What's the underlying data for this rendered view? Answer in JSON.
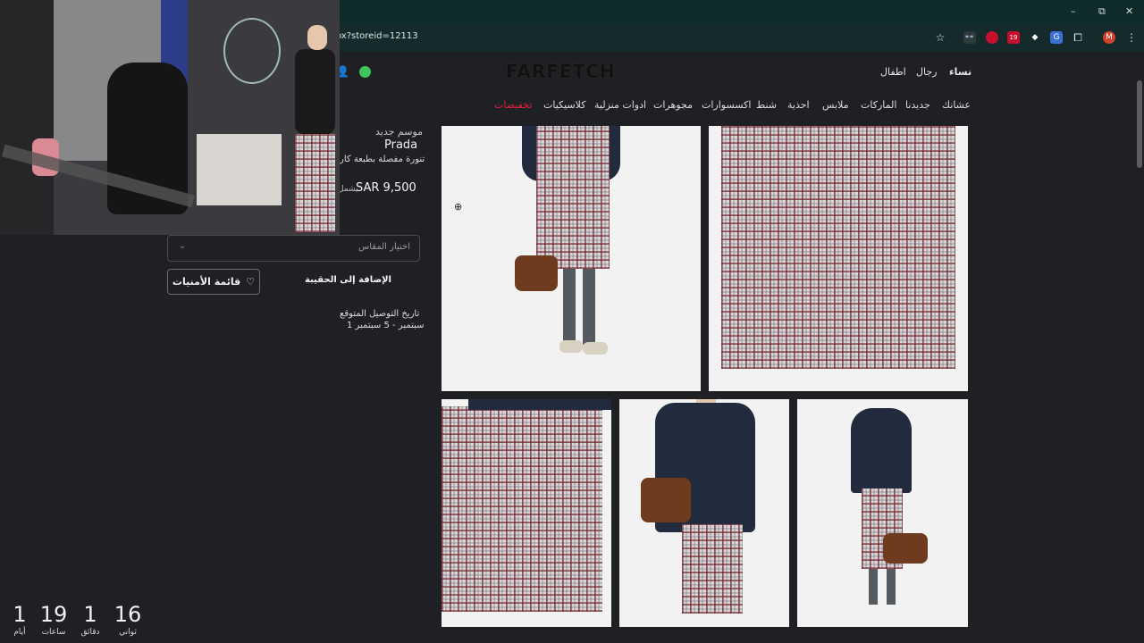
{
  "browser": {
    "url": "ox?storeid=12113",
    "window_controls": {
      "minimize": "–",
      "restore": "⧉",
      "close": "✕"
    },
    "toolbar_icons": [
      "star-icon",
      "incognito-icon",
      "extension-red-icon",
      "extension-badge-icon",
      "extension-diamond-icon",
      "translate-icon",
      "extensions-puzzle-icon",
      "profile-avatar-icon",
      "menu-kebab-icon"
    ],
    "extension_badge": "19",
    "profile_initial": "M"
  },
  "header": {
    "logo": "FARFETCH",
    "gender_links": [
      "نساء",
      "رجال",
      "اطفال"
    ],
    "nav_items": [
      "عشانك",
      "جديدنا",
      "الماركات",
      "ملابس",
      "احذية",
      "شنط",
      "اكسسوارات",
      "مجوهرات",
      "ادوات منزلية",
      "كلاسيكيات",
      "تخفيضات"
    ],
    "sale_color": "#e0203a"
  },
  "product": {
    "season": "موسم جديد",
    "brand": "Prada",
    "name": "تنورة مفصلة بطبعة كار",
    "price": "SAR 9,500",
    "price_note": "يشمل",
    "size_placeholder": "اختيار المقاس",
    "add_to_bag": "الإضافة إلى الحقيبة",
    "wishlist": "قائمة الأمنيات",
    "delivery_label": "تاريخ التوصيل المتوقع",
    "delivery_dates": "1 سبتمبر - 5 سبتمبر"
  },
  "countdown": [
    {
      "value": "1",
      "label": "أيام"
    },
    {
      "value": "19",
      "label": "ساعات"
    },
    {
      "value": "1",
      "label": "دقائق"
    },
    {
      "value": "16",
      "label": "ثواني"
    }
  ],
  "colors": {
    "titlebar": "#0f2b2b",
    "page_bg": "#1f2023",
    "accent_sale": "#e0203a"
  }
}
